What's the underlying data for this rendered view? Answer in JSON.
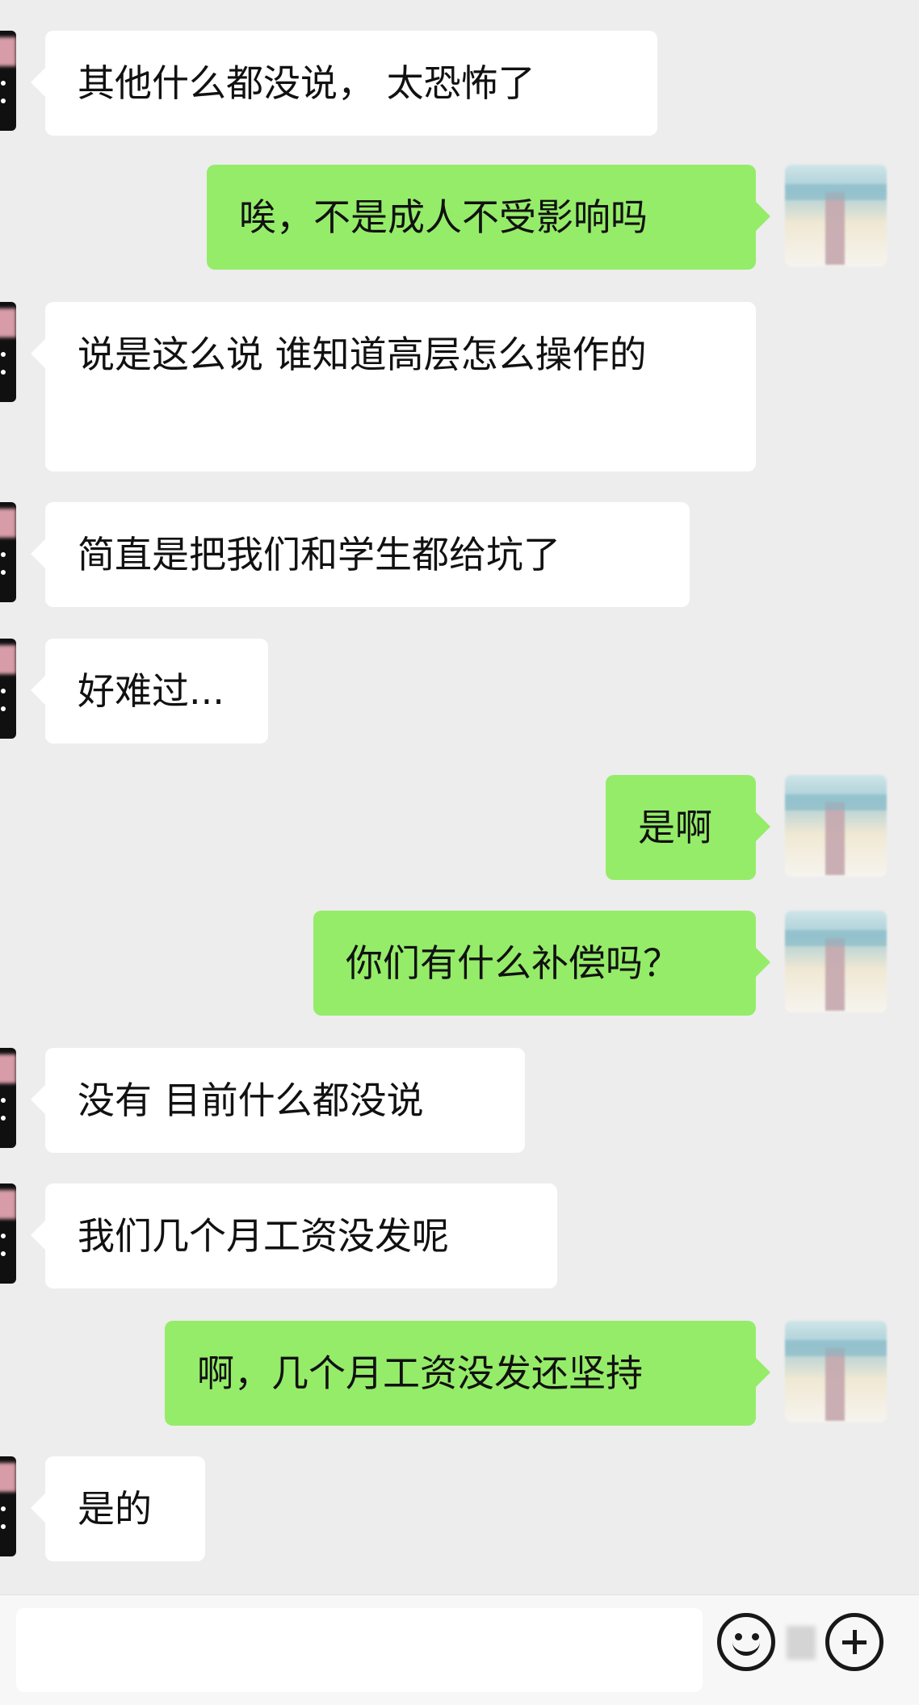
{
  "messages": [
    {
      "side": "in",
      "text": "其他什么都没说， 太恐怖了"
    },
    {
      "side": "out",
      "text": "唉，不是成人不受影响吗"
    },
    {
      "side": "in",
      "text": "说是这么说 谁知道高层怎么操作的"
    },
    {
      "side": "in",
      "text": "简直是把我们和学生都给坑了"
    },
    {
      "side": "in",
      "text": "好难过..."
    },
    {
      "side": "out",
      "text": "是啊"
    },
    {
      "side": "out",
      "text": "你们有什么补偿吗？"
    },
    {
      "side": "in",
      "text": "没有 目前什么都没说"
    },
    {
      "side": "in",
      "text": "我们几个月工资没发呢"
    },
    {
      "side": "out",
      "text": "啊，几个月工资没发还坚持"
    },
    {
      "side": "in",
      "text": "是的"
    }
  ],
  "input_bar": {
    "emoji_icon": "emoji-icon",
    "more_icon": "plus-icon"
  }
}
